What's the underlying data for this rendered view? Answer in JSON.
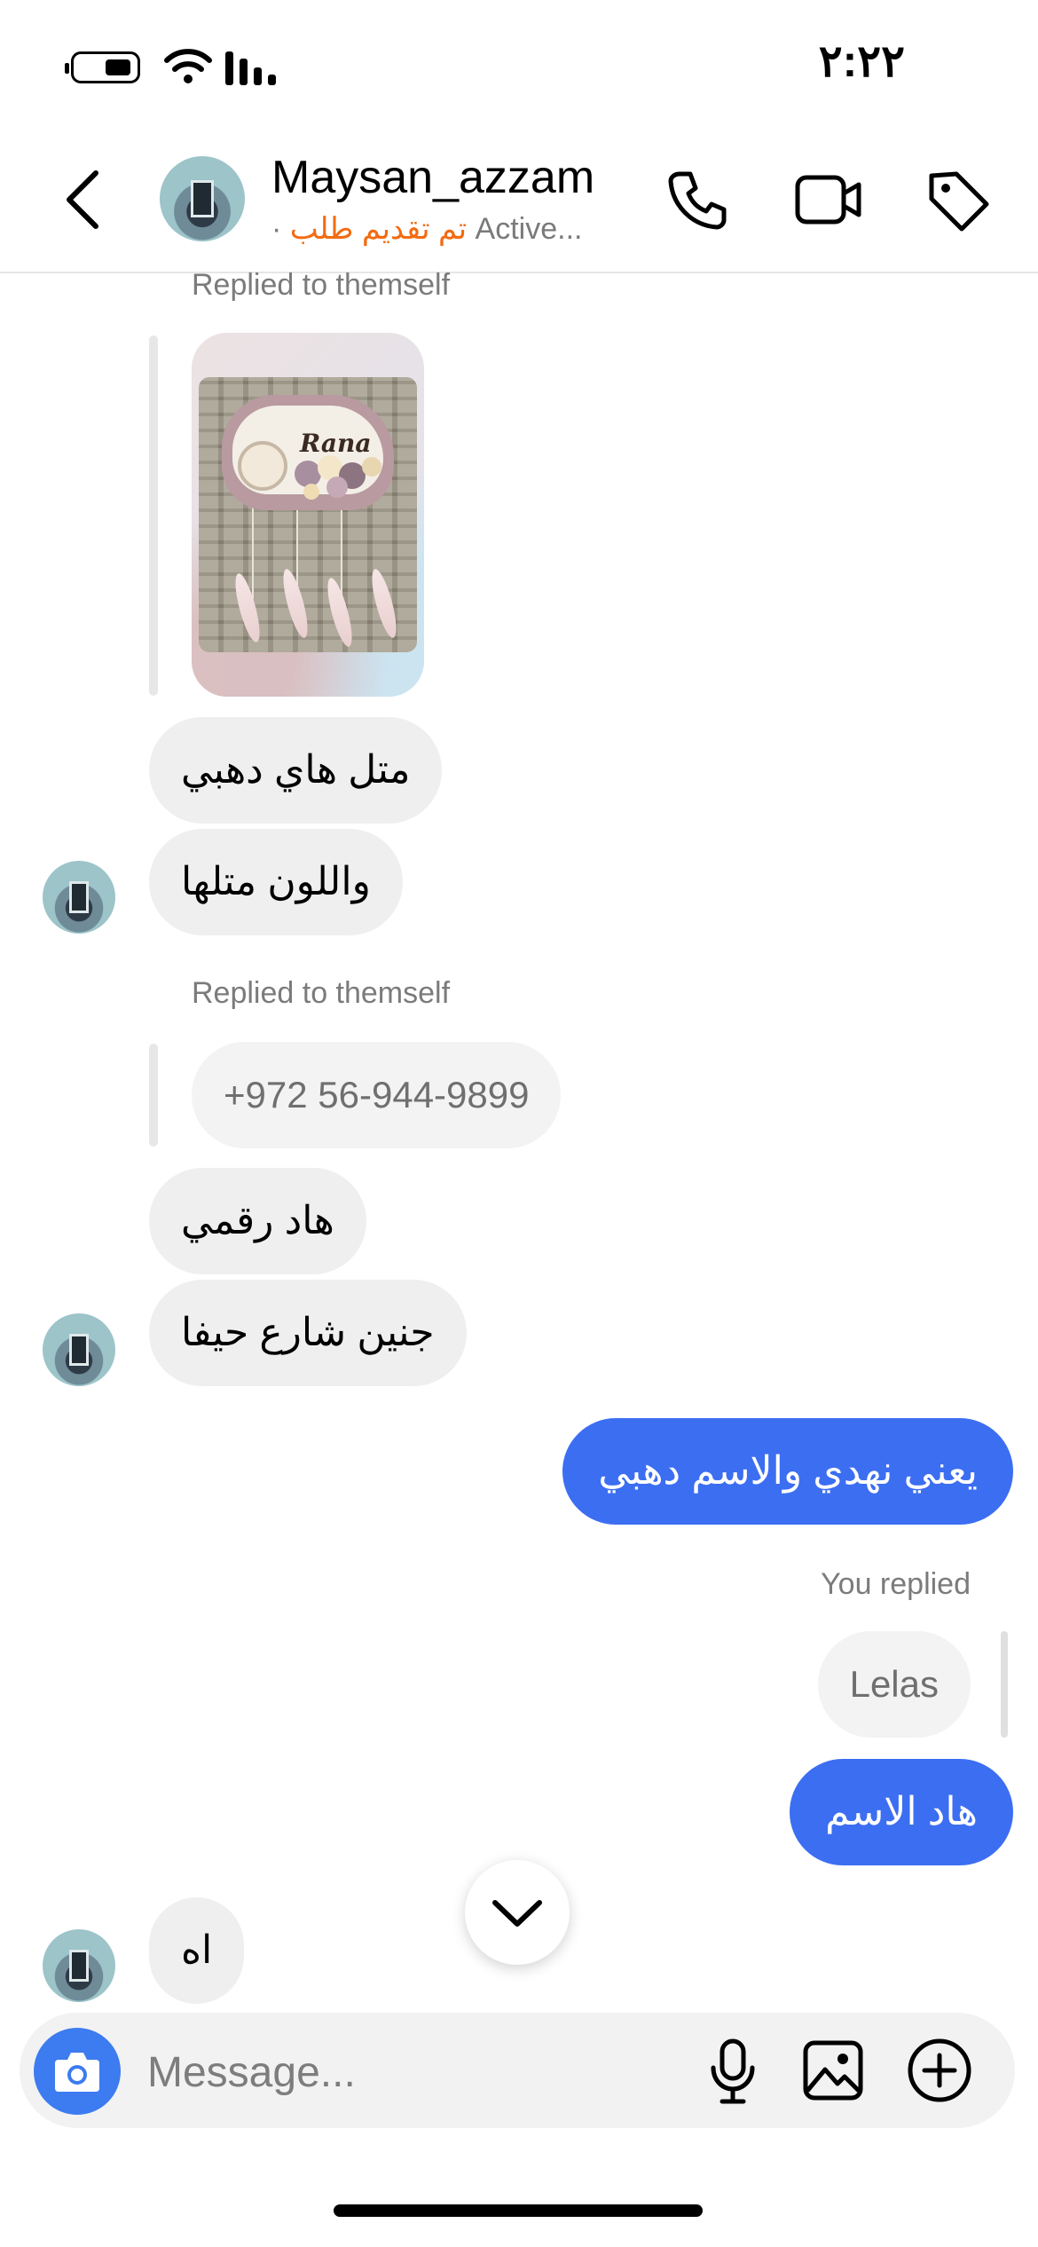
{
  "status_bar": {
    "time": "٢:٢٢"
  },
  "header": {
    "username": "Maysan_azzam",
    "status_dot": "·",
    "status_arabic": "تم تقديم طلب",
    "status_text": "Active..."
  },
  "messages": {
    "reply1_label": "Replied to themself",
    "photo_text": "Rana",
    "msg_golden": "متل هاي دهبي",
    "msg_color": "واللون متلها",
    "reply2_label": "Replied to themself",
    "phone_quote": "+972 56-944-9899",
    "msg_my_number": "هاد رقمي",
    "msg_address": "جنين شارع حيفا",
    "out_msg1": "يعني نهدي والاسم دهبي",
    "you_replied_label": "You replied",
    "quoted_name": "Lelas",
    "out_msg2": "هاد الاسم",
    "msg_ah": "اه"
  },
  "composer": {
    "placeholder": "Message..."
  },
  "colors": {
    "accent_blue": "#3c6ef2",
    "camera_blue": "#3c7bf0",
    "status_orange": "#f36b10",
    "incoming_bubble": "#efefef"
  },
  "icons": {
    "back": "chevron-left-icon",
    "call": "phone-icon",
    "video": "video-camera-icon",
    "tag": "tag-icon",
    "scroll": "chevron-down-icon",
    "camera": "camera-icon",
    "mic": "microphone-icon",
    "gallery": "image-icon",
    "plus": "plus-circle-icon"
  }
}
